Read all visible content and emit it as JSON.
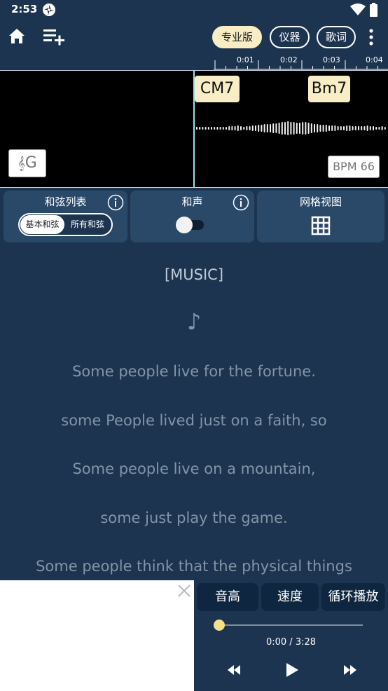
{
  "status_bar": {
    "time": "2:53"
  },
  "toolbar": {
    "pro_label": "专业版",
    "instrument_label": "仪器",
    "lyrics_label": "歌词"
  },
  "timeline": {
    "ticks": [
      "0:01",
      "0:02",
      "0:03",
      "0:04"
    ]
  },
  "waveform": {
    "chords": [
      "CM7",
      "Bm7"
    ],
    "key": "G",
    "bpm": "BPM 66"
  },
  "options": {
    "chord_list_title": "和弦列表",
    "chord_toggle_basic": "基本和弦",
    "chord_toggle_all": "所有和弦",
    "chord_toggle_selected": "基本和弦",
    "harmony_title": "和声",
    "harmony_enabled": false,
    "grid_title": "网格视图"
  },
  "lyrics": {
    "section": "[MUSIC]",
    "note": "♪",
    "lines": [
      "Some people live for the fortune.",
      "some People lived just on a faith, so",
      "Some people live on a mountain,",
      "some just play the game.",
      "Some people think that the physical things"
    ]
  },
  "player": {
    "pitch_label": "音高",
    "speed_label": "速度",
    "loop_label": "循环播放",
    "time": "0:00 / 3:28",
    "progress": 0.0
  },
  "colors": {
    "background": "#1d3450",
    "card": "#2a4868",
    "accent_cream": "#f8edc4",
    "progress": "#f5e08a",
    "playhead": "#9fe0e8"
  }
}
